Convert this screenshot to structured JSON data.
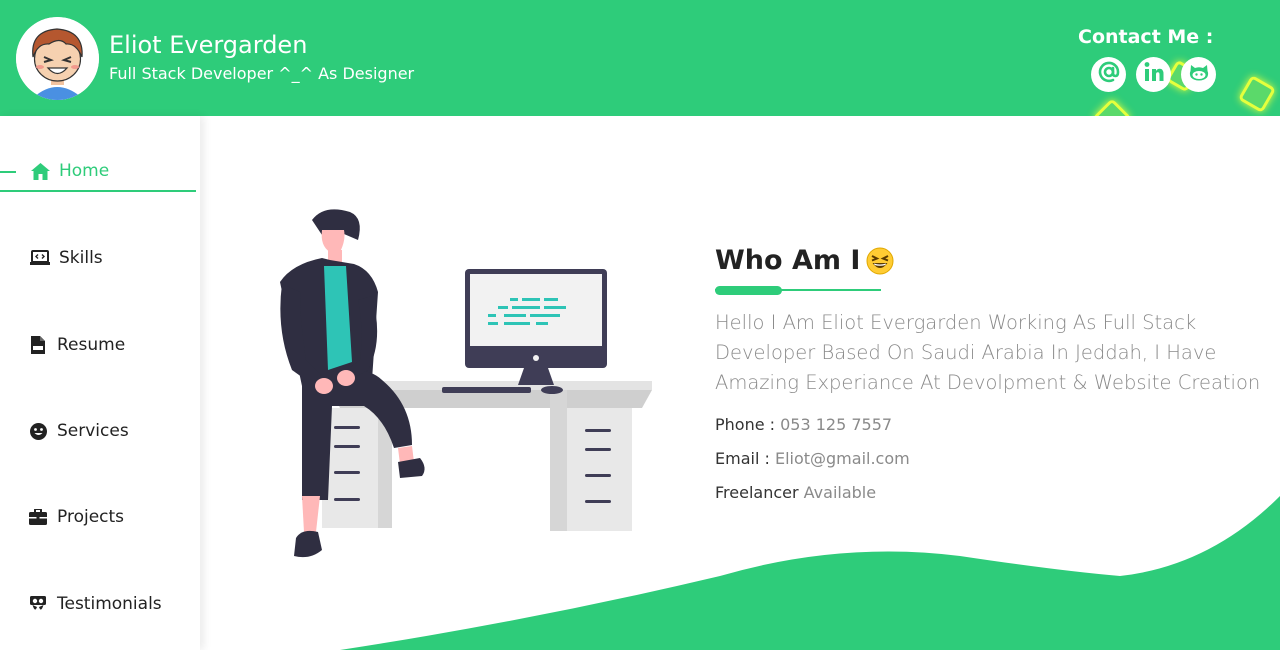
{
  "header": {
    "name": "Eliot Evergarden",
    "subtitle": "Full Stack Developer ^_^ As Designer",
    "contact_title": "Contact Me :",
    "social": [
      {
        "icon": "at-sign-icon"
      },
      {
        "icon": "linkedin-icon"
      },
      {
        "icon": "github-icon"
      }
    ]
  },
  "sidebar": {
    "items": [
      {
        "label": "Home",
        "icon": "home-icon",
        "active": true
      },
      {
        "label": "Skills",
        "icon": "laptop-code-icon"
      },
      {
        "label": "Resume",
        "icon": "pdf-file-icon"
      },
      {
        "label": "Services",
        "icon": "smile-icon"
      },
      {
        "label": "Projects",
        "icon": "briefcase-icon"
      },
      {
        "label": "Testimonials",
        "icon": "slideshare-icon"
      }
    ]
  },
  "about": {
    "title": "Who Am I",
    "bio": "Hello I Am Eliot Evergarden Working As Full Stack Developer Based On Saudi Arabia In Jeddah, I Have Amazing Experiance At Devolpment & Website Creation",
    "phone_label": "Phone : ",
    "phone_value": "053 125 7557",
    "email_label": "Email : ",
    "email_value": "Eliot@gmail.com",
    "freelancer_label": "Freelancer ",
    "freelancer_value": "Available"
  },
  "colors": {
    "accent": "#2ecc7a",
    "text": "#222222",
    "muted": "#8a8a8a",
    "highlight": "#e5ff3d"
  }
}
